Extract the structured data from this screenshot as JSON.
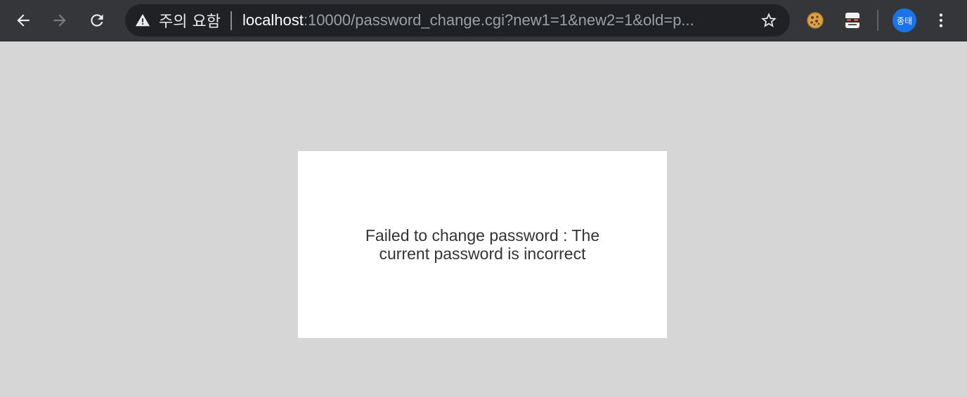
{
  "browser": {
    "nav": {
      "back_icon": "arrow-left-icon",
      "forward_icon": "arrow-right-icon",
      "reload_icon": "reload-icon"
    },
    "omnibox": {
      "security_icon": "warning-triangle-icon",
      "security_label": "주의 요함",
      "url_host": "localhost",
      "url_rest": ":10000/password_change.cgi?new1=1&new2=1&old=p...",
      "bookmark_icon": "star-outline-icon"
    },
    "extensions": [
      {
        "name": "cookie-extension-icon"
      },
      {
        "name": "spy-extension-icon"
      }
    ],
    "profile": {
      "initials": "종태",
      "color": "#1a73e8"
    },
    "menu_icon": "more-vert-icon"
  },
  "page": {
    "message": "Failed to change password : The current password is incorrect",
    "background": "#d6d6d6",
    "box_color": "#ffffff"
  }
}
